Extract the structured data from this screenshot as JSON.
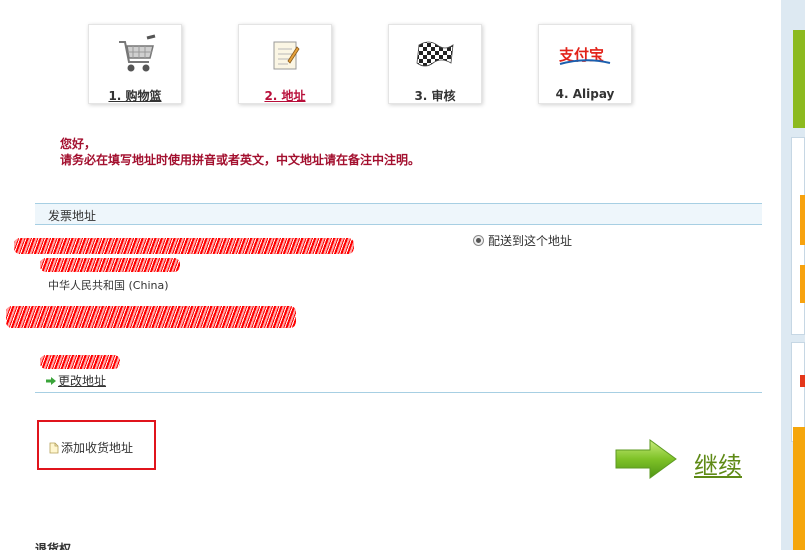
{
  "steps": [
    {
      "label": "1. 购物篮",
      "icon": "shopping-cart-icon"
    },
    {
      "label": "2. 地址",
      "icon": "notepad-icon"
    },
    {
      "label": "3. 审核",
      "icon": "checkered-flag-icon"
    },
    {
      "label": "4. Alipay",
      "icon": "alipay-logo"
    }
  ],
  "notice": {
    "line1": "您好，",
    "line2": "请务必在填写地址时使用拼音或者英文，中文地址请在备注中注明。"
  },
  "billing": {
    "section_title": "发票地址",
    "country": "中华人民共和国 (China)",
    "ship_option_label": "配送到这个地址",
    "change_link": "更改地址"
  },
  "add_address_label": "添加收货地址",
  "continue_label": "继续",
  "bottom_heading": "退货权",
  "colors": {
    "accent_red": "#a3102f",
    "section_border": "#a7cfe3",
    "continue_green": "#5f8a16",
    "highlight_box": "#e0141c"
  }
}
